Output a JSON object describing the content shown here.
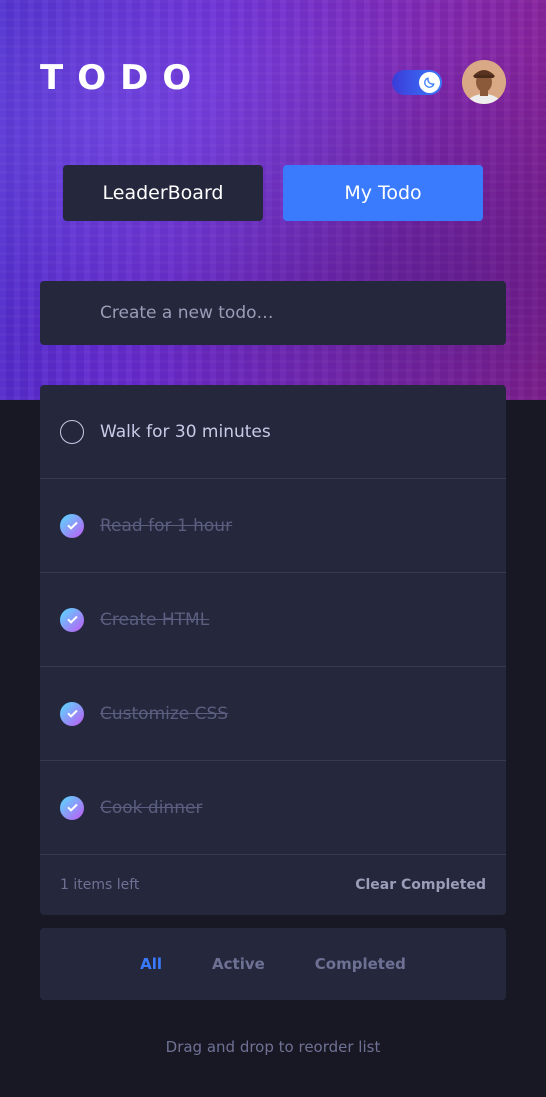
{
  "header": {
    "logo": "TODO",
    "theme_toggle_icon": "moon-icon",
    "avatar_icon": "user-avatar"
  },
  "tabs": [
    {
      "label": "LeaderBoard"
    },
    {
      "label": "My Todo"
    }
  ],
  "new_todo": {
    "placeholder": "Create a new todo…",
    "value": ""
  },
  "todos": [
    {
      "text": "Walk for 30 minutes",
      "completed": false
    },
    {
      "text": "Read for 1 hour",
      "completed": true
    },
    {
      "text": "Create HTML",
      "completed": true
    },
    {
      "text": "Customize CSS",
      "completed": true
    },
    {
      "text": "Cook dinner",
      "completed": true
    }
  ],
  "footer": {
    "items_left": "1 items left",
    "clear_label": "Clear Completed"
  },
  "filters": {
    "all": "All",
    "active": "Active",
    "completed": "Completed",
    "selected": "All"
  },
  "hint": "Drag and drop to reorder list",
  "colors": {
    "accent": "#3a7bfd",
    "card": "#25273d",
    "background": "#171823",
    "check_gradient_start": "#55ddff",
    "check_gradient_end": "#c058f3"
  }
}
